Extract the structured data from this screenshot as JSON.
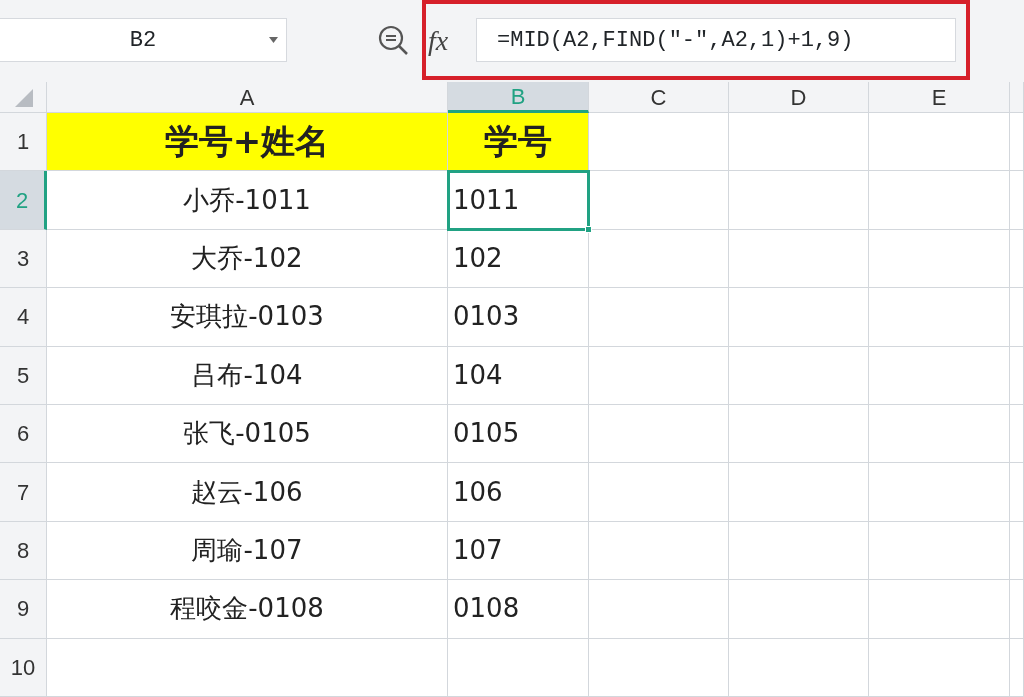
{
  "name_box": {
    "value": "B2"
  },
  "formula_bar": {
    "label": "fx",
    "value": "=MID(A2,FIND(\"-\",A2,1)+1,9)",
    "highlighted": true
  },
  "columns": [
    {
      "label": "A",
      "selected": false
    },
    {
      "label": "B",
      "selected": true
    },
    {
      "label": "C",
      "selected": false
    },
    {
      "label": "D",
      "selected": false
    },
    {
      "label": "E",
      "selected": false
    }
  ],
  "rows": [
    {
      "number": "1",
      "selected": false,
      "kind": "header",
      "cells": [
        {
          "text": "学号+姓名",
          "selected": false
        },
        {
          "text": "学号",
          "selected": false
        }
      ]
    },
    {
      "number": "2",
      "selected": true,
      "kind": "data",
      "cells": [
        {
          "text": "小乔-1011",
          "selected": false
        },
        {
          "text": "1011",
          "selected": true
        }
      ]
    },
    {
      "number": "3",
      "selected": false,
      "kind": "data",
      "cells": [
        {
          "text": "大乔-102",
          "selected": false
        },
        {
          "text": "102",
          "selected": false
        }
      ]
    },
    {
      "number": "4",
      "selected": false,
      "kind": "data",
      "cells": [
        {
          "text": "安琪拉-0103",
          "selected": false
        },
        {
          "text": "0103",
          "selected": false
        }
      ]
    },
    {
      "number": "5",
      "selected": false,
      "kind": "data",
      "cells": [
        {
          "text": "吕布-104",
          "selected": false
        },
        {
          "text": "104",
          "selected": false
        }
      ]
    },
    {
      "number": "6",
      "selected": false,
      "kind": "data",
      "cells": [
        {
          "text": "张飞-0105",
          "selected": false
        },
        {
          "text": "0105",
          "selected": false
        }
      ]
    },
    {
      "number": "7",
      "selected": false,
      "kind": "data",
      "cells": [
        {
          "text": "赵云-106",
          "selected": false
        },
        {
          "text": "106",
          "selected": false
        }
      ]
    },
    {
      "number": "8",
      "selected": false,
      "kind": "data",
      "cells": [
        {
          "text": "周瑜-107",
          "selected": false
        },
        {
          "text": "107",
          "selected": false
        }
      ]
    },
    {
      "number": "9",
      "selected": false,
      "kind": "data",
      "cells": [
        {
          "text": "程咬金-0108",
          "selected": false
        },
        {
          "text": "0108",
          "selected": false
        }
      ]
    },
    {
      "number": "10",
      "selected": false,
      "kind": "data"
    }
  ]
}
